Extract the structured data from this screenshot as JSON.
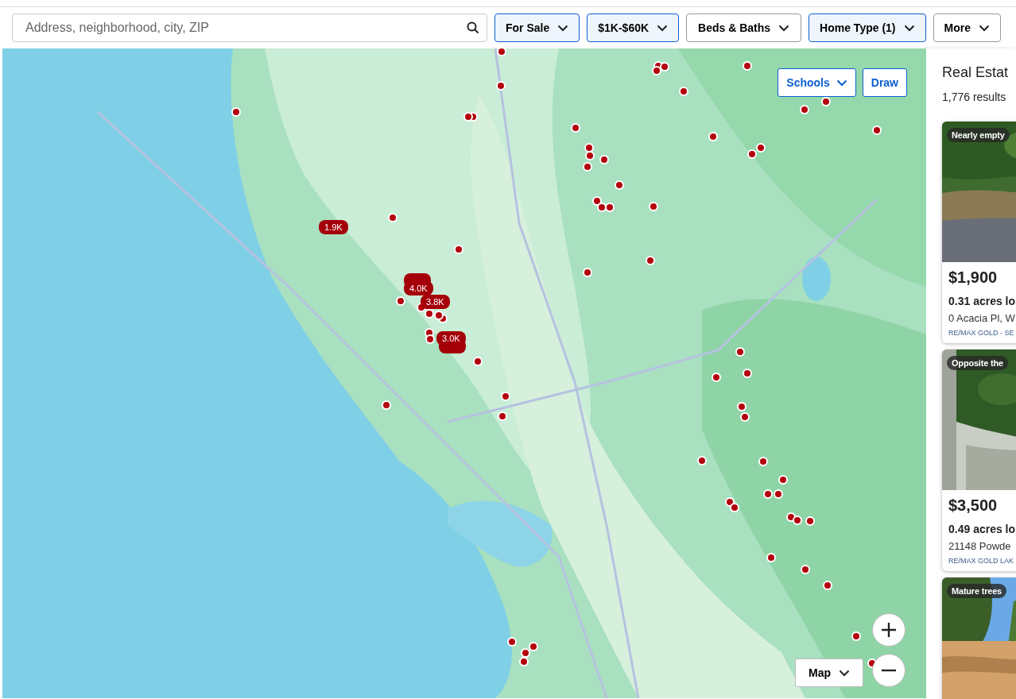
{
  "search": {
    "placeholder": "Address, neighborhood, city, ZIP"
  },
  "filters": [
    {
      "label": "For Sale",
      "active": true
    },
    {
      "label": "$1K-$60K",
      "active": true
    },
    {
      "label": "Beds & Baths",
      "active": false
    },
    {
      "label": "Home Type (1)",
      "active": true
    },
    {
      "label": "More",
      "active": false
    }
  ],
  "map": {
    "tools": [
      {
        "label": "Schools",
        "dropdown": true
      },
      {
        "label": "Draw",
        "dropdown": false
      }
    ],
    "price_pins": [
      {
        "label": "1.9K"
      },
      {
        "label": "4.0K"
      },
      {
        "label": "3.8K"
      },
      {
        "label": "3.0K"
      }
    ],
    "map_type": "Map"
  },
  "results": {
    "title": "Real Estat",
    "count": "1,776 results",
    "listings": [
      {
        "tag": "Nearly empty",
        "price": "$1,900",
        "details": "0.31 acres lo",
        "address": "0 Acacia Pl, W",
        "broker": "RE/MAX GOLD - SE"
      },
      {
        "tag": "Opposite the",
        "price": "$3,500",
        "details": "0.49 acres lo",
        "address": "21148 Powde",
        "broker": "RE/MAX GOLD LAK"
      },
      {
        "tag": "Mature trees"
      }
    ]
  }
}
